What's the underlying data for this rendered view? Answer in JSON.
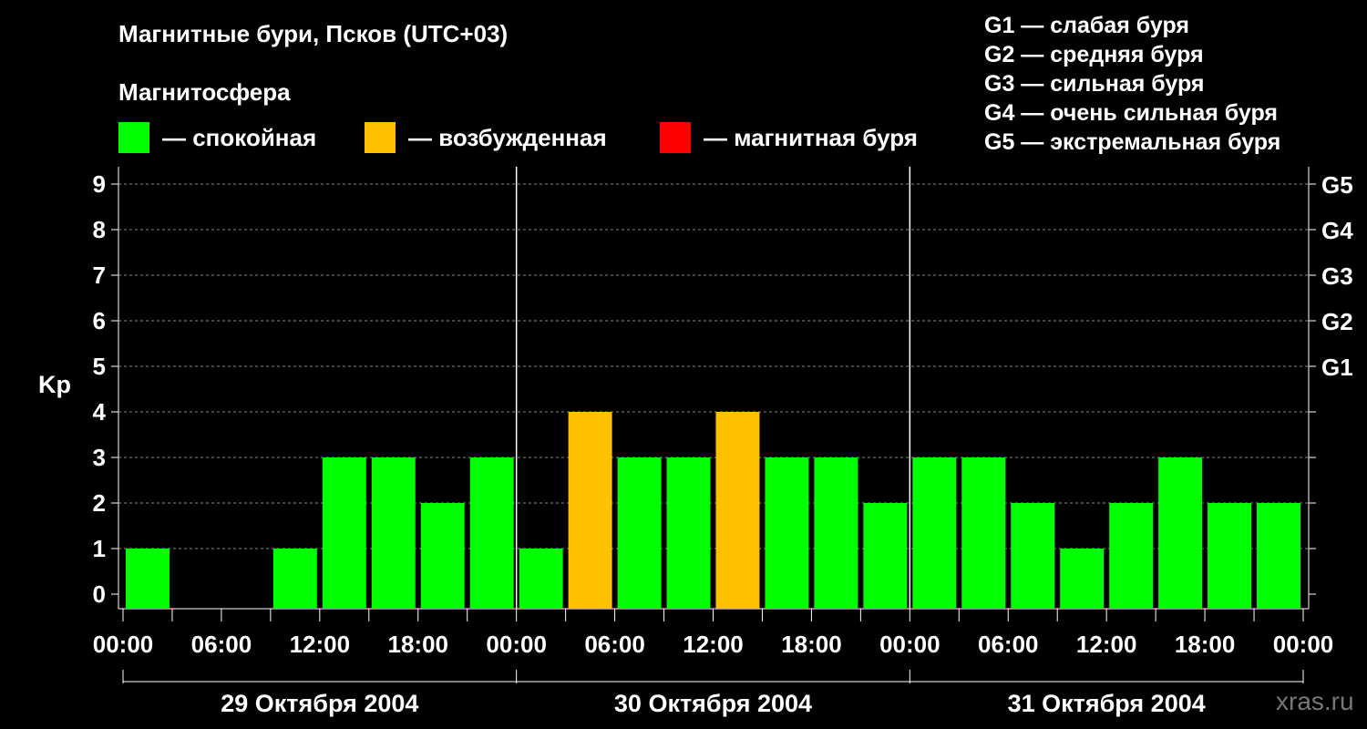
{
  "title": "Магнитные бури, Псков (UTC+03)",
  "subtitle": "Магнитосфера",
  "legend": [
    {
      "label": "— спокойная",
      "color": "#00ff00"
    },
    {
      "label": "— возбужденная",
      "color": "#ffc000"
    },
    {
      "label": "— магнитная буря",
      "color": "#ff0000"
    }
  ],
  "g_scale": [
    "G1 — слабая буря",
    "G2 — средняя буря",
    "G3 — сильная буря",
    "G4 — очень сильная буря",
    "G5 — экстремальная буря"
  ],
  "watermark": "xras.ru",
  "chart_data": {
    "type": "bar",
    "ylabel": "Kp",
    "ylim": [
      0,
      9
    ],
    "yticks": [
      "0",
      "1",
      "2",
      "3",
      "4",
      "5",
      "6",
      "7",
      "8",
      "9"
    ],
    "right_ticks": [
      {
        "kp": 5,
        "label": "G1"
      },
      {
        "kp": 6,
        "label": "G2"
      },
      {
        "kp": 7,
        "label": "G3"
      },
      {
        "kp": 8,
        "label": "G4"
      },
      {
        "kp": 9,
        "label": "G5"
      }
    ],
    "xtick_labels": [
      "00:00",
      "06:00",
      "12:00",
      "18:00",
      "00:00",
      "06:00",
      "12:00",
      "18:00",
      "00:00",
      "06:00",
      "12:00",
      "18:00",
      "00:00"
    ],
    "days": [
      "29 Октября 2004",
      "30 Октября 2004",
      "31 Октября 2004"
    ],
    "interval_hours": 3,
    "values": [
      1,
      0,
      0,
      1,
      3,
      3,
      2,
      3,
      1,
      4,
      3,
      3,
      4,
      3,
      3,
      2,
      3,
      3,
      2,
      1,
      2,
      3,
      2,
      2
    ],
    "level_colors": {
      "quiet": "#00ff00",
      "active": "#ffc000",
      "storm": "#ff0000"
    },
    "grid": true
  }
}
